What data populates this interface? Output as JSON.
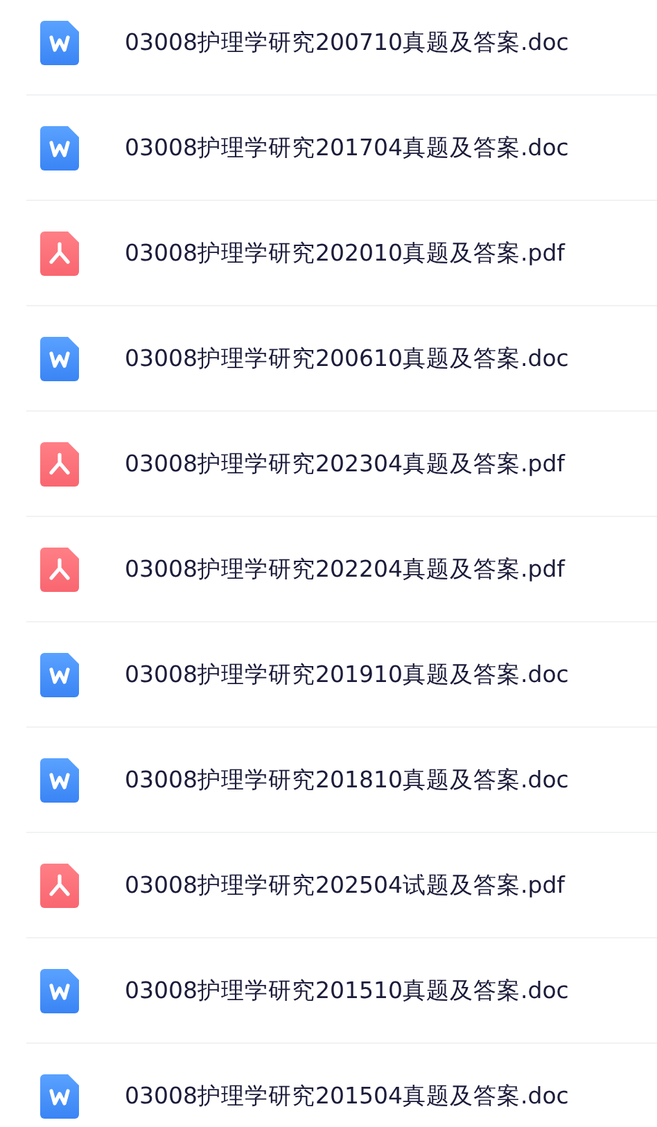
{
  "files": [
    {
      "kind": "doc",
      "name": "03008护理学研究200710真题及答案.doc"
    },
    {
      "kind": "doc",
      "name": "03008护理学研究201704真题及答案.doc"
    },
    {
      "kind": "pdf",
      "name": "03008护理学研究202010真题及答案.pdf"
    },
    {
      "kind": "doc",
      "name": "03008护理学研究200610真题及答案.doc"
    },
    {
      "kind": "pdf",
      "name": "03008护理学研究202304真题及答案.pdf"
    },
    {
      "kind": "pdf",
      "name": "03008护理学研究202204真题及答案.pdf"
    },
    {
      "kind": "doc",
      "name": "03008护理学研究201910真题及答案.doc"
    },
    {
      "kind": "doc",
      "name": "03008护理学研究201810真题及答案.doc"
    },
    {
      "kind": "pdf",
      "name": "03008护理学研究202504试题及答案.pdf"
    },
    {
      "kind": "doc",
      "name": "03008护理学研究201510真题及答案.doc"
    },
    {
      "kind": "doc",
      "name": "03008护理学研究201504真题及答案.doc"
    }
  ]
}
